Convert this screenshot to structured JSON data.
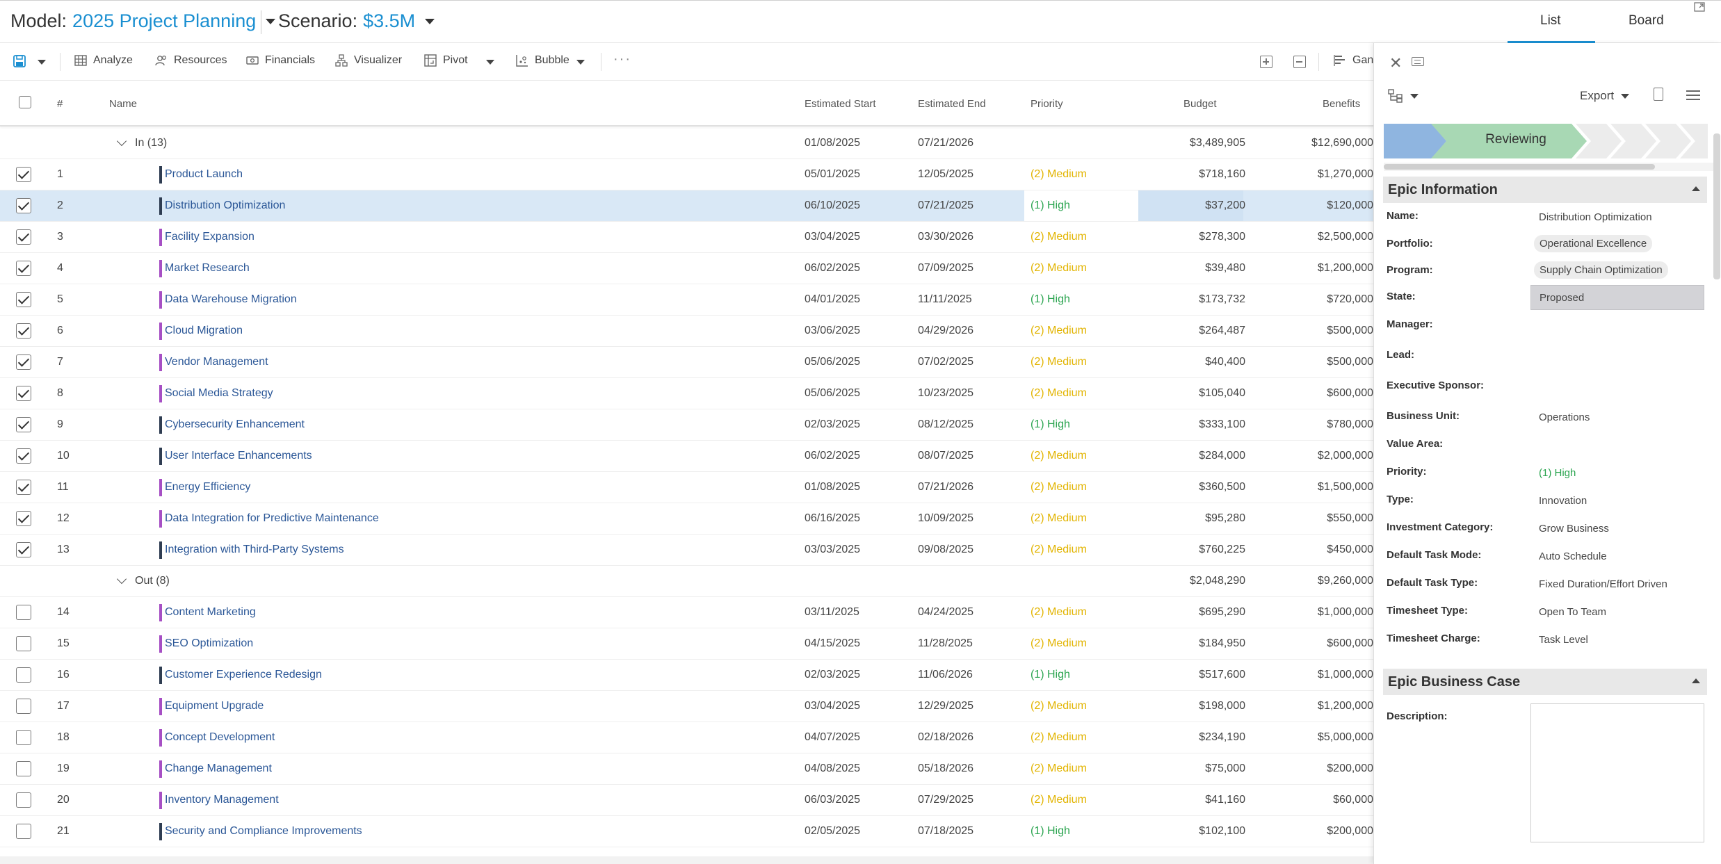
{
  "header": {
    "model_label": "Model:",
    "model_value": "2025 Project Planning",
    "scenario_label": "Scenario:",
    "scenario_value": "$3.5M",
    "tabs": [
      "List",
      "Board"
    ]
  },
  "toolbar": {
    "analyze": "Analyze",
    "resources": "Resources",
    "financials": "Financials",
    "visualizer": "Visualizer",
    "pivot": "Pivot",
    "bubble": "Bubble",
    "more": "···",
    "gantt": "Gan"
  },
  "grid": {
    "columns": {
      "num": "#",
      "name": "Name",
      "start": "Estimated Start",
      "end": "Estimated End",
      "priority": "Priority",
      "budget": "Budget",
      "benefits": "Benefits"
    },
    "groups": [
      {
        "label": "In (13)",
        "start": "01/08/2025",
        "end": "07/21/2026",
        "budget": "$3,489,905",
        "benefits": "$12,690,000",
        "rows": [
          {
            "n": "1",
            "name": "Product Launch",
            "start": "05/01/2025",
            "end": "12/05/2025",
            "priority": "(2) Medium",
            "level": "medium",
            "budget": "$718,160",
            "benefits": "$1,270,000",
            "checked": true,
            "bar": "#2f3d52"
          },
          {
            "n": "2",
            "name": "Distribution Optimization",
            "start": "06/10/2025",
            "end": "07/21/2025",
            "priority": "(1) High",
            "level": "high",
            "budget": "$37,200",
            "benefits": "$120,000",
            "checked": true,
            "bar": "#2f3d52",
            "selected": true
          },
          {
            "n": "3",
            "name": "Facility Expansion",
            "start": "03/04/2025",
            "end": "03/30/2026",
            "priority": "(2) Medium",
            "level": "medium",
            "budget": "$278,300",
            "benefits": "$2,500,000",
            "checked": true,
            "bar": "#a64fc4"
          },
          {
            "n": "4",
            "name": "Market Research",
            "start": "06/02/2025",
            "end": "07/09/2025",
            "priority": "(2) Medium",
            "level": "medium",
            "budget": "$39,480",
            "benefits": "$1,200,000",
            "checked": true,
            "bar": "#a64fc4"
          },
          {
            "n": "5",
            "name": "Data Warehouse Migration",
            "start": "04/01/2025",
            "end": "11/11/2025",
            "priority": "(1) High",
            "level": "high",
            "budget": "$173,732",
            "benefits": "$720,000",
            "checked": true,
            "bar": "#a64fc4"
          },
          {
            "n": "6",
            "name": "Cloud Migration",
            "start": "03/06/2025",
            "end": "04/29/2026",
            "priority": "(2) Medium",
            "level": "medium",
            "budget": "$264,487",
            "benefits": "$500,000",
            "checked": true,
            "bar": "#a64fc4"
          },
          {
            "n": "7",
            "name": "Vendor Management",
            "start": "05/06/2025",
            "end": "07/02/2025",
            "priority": "(2) Medium",
            "level": "medium",
            "budget": "$40,400",
            "benefits": "$500,000",
            "checked": true,
            "bar": "#a64fc4"
          },
          {
            "n": "8",
            "name": "Social Media Strategy",
            "start": "05/06/2025",
            "end": "10/23/2025",
            "priority": "(2) Medium",
            "level": "medium",
            "budget": "$105,040",
            "benefits": "$600,000",
            "checked": true,
            "bar": "#a64fc4"
          },
          {
            "n": "9",
            "name": "Cybersecurity Enhancement",
            "start": "02/03/2025",
            "end": "08/12/2025",
            "priority": "(1) High",
            "level": "high",
            "budget": "$333,100",
            "benefits": "$780,000",
            "checked": true,
            "bar": "#2f3d52"
          },
          {
            "n": "10",
            "name": "User Interface Enhancements",
            "start": "06/02/2025",
            "end": "08/07/2025",
            "priority": "(2) Medium",
            "level": "medium",
            "budget": "$284,000",
            "benefits": "$2,000,000",
            "checked": true,
            "bar": "#2f3d52"
          },
          {
            "n": "11",
            "name": "Energy Efficiency",
            "start": "01/08/2025",
            "end": "07/21/2026",
            "priority": "(2) Medium",
            "level": "medium",
            "budget": "$360,500",
            "benefits": "$1,500,000",
            "checked": true,
            "bar": "#a64fc4"
          },
          {
            "n": "12",
            "name": "Data Integration for Predictive Maintenance",
            "start": "06/16/2025",
            "end": "10/09/2025",
            "priority": "(2) Medium",
            "level": "medium",
            "budget": "$95,280",
            "benefits": "$550,000",
            "checked": true,
            "bar": "#a64fc4"
          },
          {
            "n": "13",
            "name": "Integration with Third-Party Systems",
            "start": "03/03/2025",
            "end": "09/08/2025",
            "priority": "(2) Medium",
            "level": "medium",
            "budget": "$760,225",
            "benefits": "$450,000",
            "checked": true,
            "bar": "#2f3d52"
          }
        ]
      },
      {
        "label": "Out (8)",
        "start": "",
        "end": "",
        "budget": "$2,048,290",
        "benefits": "$9,260,000",
        "rows": [
          {
            "n": "14",
            "name": "Content Marketing",
            "start": "03/11/2025",
            "end": "04/24/2025",
            "priority": "(2) Medium",
            "level": "medium",
            "budget": "$695,290",
            "benefits": "$1,000,000",
            "checked": false,
            "bar": "#a64fc4"
          },
          {
            "n": "15",
            "name": "SEO Optimization",
            "start": "04/15/2025",
            "end": "11/28/2025",
            "priority": "(2) Medium",
            "level": "medium",
            "budget": "$184,950",
            "benefits": "$600,000",
            "checked": false,
            "bar": "#a64fc4"
          },
          {
            "n": "16",
            "name": "Customer Experience Redesign",
            "start": "02/03/2025",
            "end": "11/06/2026",
            "priority": "(1) High",
            "level": "high",
            "budget": "$517,600",
            "benefits": "$1,000,000",
            "checked": false,
            "bar": "#2f3d52"
          },
          {
            "n": "17",
            "name": "Equipment Upgrade",
            "start": "03/04/2025",
            "end": "12/29/2025",
            "priority": "(2) Medium",
            "level": "medium",
            "budget": "$198,000",
            "benefits": "$1,200,000",
            "checked": false,
            "bar": "#a64fc4"
          },
          {
            "n": "18",
            "name": "Concept Development",
            "start": "04/07/2025",
            "end": "02/18/2026",
            "priority": "(2) Medium",
            "level": "medium",
            "budget": "$234,190",
            "benefits": "$5,000,000",
            "checked": false,
            "bar": "#a64fc4"
          },
          {
            "n": "19",
            "name": "Change Management",
            "start": "04/08/2025",
            "end": "05/18/2026",
            "priority": "(2) Medium",
            "level": "medium",
            "budget": "$75,000",
            "benefits": "$200,000",
            "checked": false,
            "bar": "#a64fc4"
          },
          {
            "n": "20",
            "name": "Inventory Management",
            "start": "06/03/2025",
            "end": "07/29/2025",
            "priority": "(2) Medium",
            "level": "medium",
            "budget": "$41,160",
            "benefits": "$60,000",
            "checked": false,
            "bar": "#a64fc4"
          },
          {
            "n": "21",
            "name": "Security and Compliance Improvements",
            "start": "02/05/2025",
            "end": "07/18/2025",
            "priority": "(1) High",
            "level": "high",
            "budget": "$102,100",
            "benefits": "$200,000",
            "checked": false,
            "bar": "#2f3d52"
          }
        ]
      }
    ]
  },
  "panel": {
    "export_label": "Export",
    "stage": "Reviewing",
    "epic_info": {
      "title": "Epic Information",
      "fields": [
        {
          "label": "Name:",
          "value": "Distribution Optimization",
          "kind": "text"
        },
        {
          "label": "Portfolio:",
          "value": "Operational Excellence",
          "kind": "pill"
        },
        {
          "label": "Program:",
          "value": "Supply Chain Optimization",
          "kind": "pill"
        },
        {
          "label": "State:",
          "value": "Proposed",
          "kind": "state"
        },
        {
          "label": "Manager:",
          "value": "",
          "kind": "text"
        },
        {
          "label": "Lead:",
          "value": "",
          "kind": "text"
        },
        {
          "label": "Executive Sponsor:",
          "value": "",
          "kind": "text"
        },
        {
          "label": "Business Unit:",
          "value": "Operations",
          "kind": "text"
        },
        {
          "label": "Value Area:",
          "value": "",
          "kind": "text"
        },
        {
          "label": "Priority:",
          "value": "(1) High",
          "kind": "high"
        },
        {
          "label": "Type:",
          "value": "Innovation",
          "kind": "text"
        },
        {
          "label": "Investment Category:",
          "value": "Grow Business",
          "kind": "text"
        },
        {
          "label": "Default Task Mode:",
          "value": "Auto Schedule",
          "kind": "text"
        },
        {
          "label": "Default Task Type:",
          "value": "Fixed Duration/Effort Driven",
          "kind": "text"
        },
        {
          "label": "Timesheet Type:",
          "value": "Open To Team",
          "kind": "text"
        },
        {
          "label": "Timesheet Charge:",
          "value": "Task Level",
          "kind": "text"
        }
      ]
    },
    "business_case": {
      "title": "Epic Business Case",
      "description_label": "Description:"
    }
  },
  "colors": {
    "accent": "#1a8fd1",
    "priority_medium": "#e2b400",
    "priority_high": "#2aa44f",
    "selected_row": "#d9e8f6",
    "stage_done": "#8fb5e0",
    "stage_current": "#a8d8b4"
  }
}
